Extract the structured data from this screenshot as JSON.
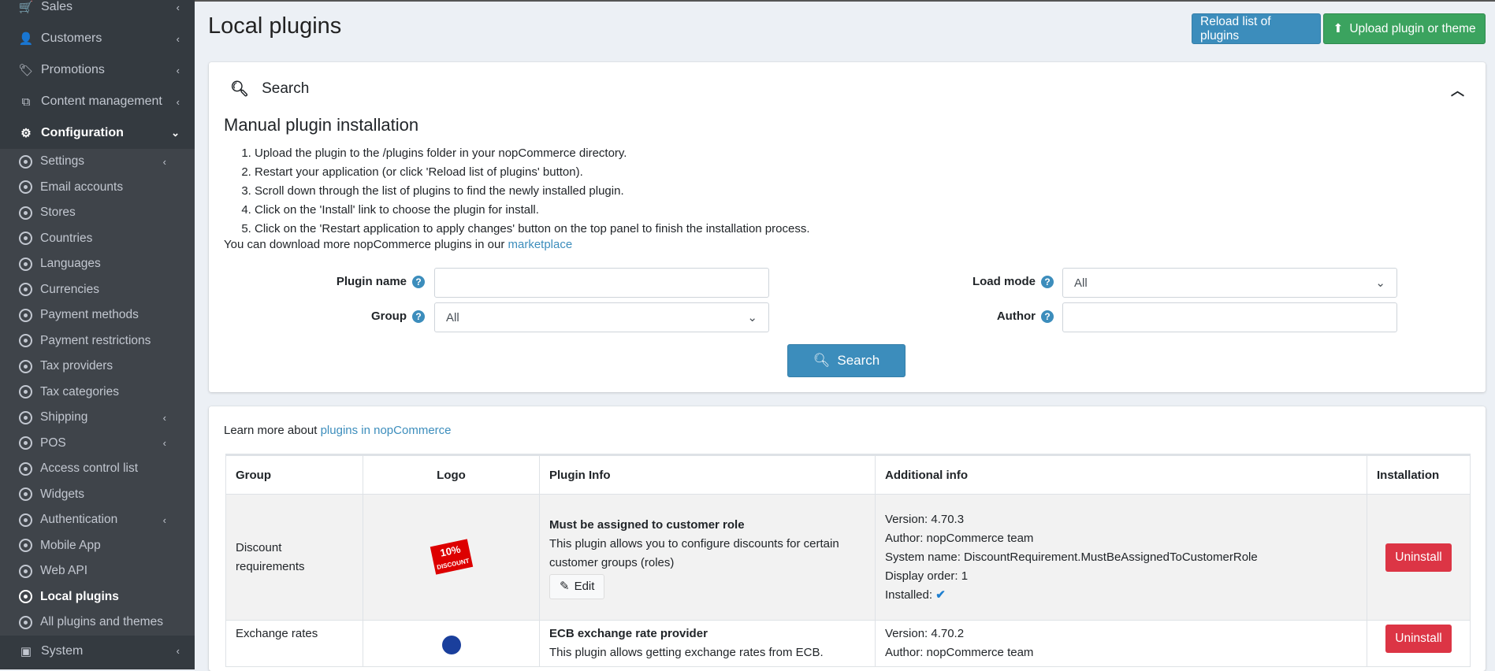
{
  "sidebar": {
    "top_items": [
      {
        "label": "Sales",
        "icon": "cart-icon"
      },
      {
        "label": "Customers",
        "icon": "user-icon"
      },
      {
        "label": "Promotions",
        "icon": "tags-icon"
      },
      {
        "label": "Content management",
        "icon": "cubes-icon"
      },
      {
        "label": "Configuration",
        "icon": "gears-icon"
      }
    ],
    "sub_items": [
      "Settings",
      "Email accounts",
      "Stores",
      "Countries",
      "Languages",
      "Currencies",
      "Payment methods",
      "Payment restrictions",
      "Tax providers",
      "Tax categories",
      "Shipping",
      "POS",
      "Access control list",
      "Widgets",
      "Authentication",
      "Mobile App",
      "Web API",
      "Local plugins",
      "All plugins and themes"
    ],
    "bottom_item": "System"
  },
  "header": {
    "title": "Local plugins",
    "reload_label": "Reload list of plugins",
    "upload_label": "Upload plugin or theme"
  },
  "search": {
    "title": "Search",
    "manual_title": "Manual plugin installation",
    "steps": [
      "Upload the plugin to the /plugins folder in your nopCommerce directory.",
      "Restart your application (or click 'Reload list of plugins' button).",
      "Scroll down through the list of plugins to find the newly installed plugin.",
      "Click on the 'Install' link to choose the plugin for install.",
      "Click on the 'Restart application to apply changes' button on the top panel to finish the installation process."
    ],
    "more_text": "You can download more nopCommerce plugins in our ",
    "more_link": "marketplace",
    "plugin_name_label": "Plugin name",
    "plugin_name_value": "",
    "group_label": "Group",
    "group_value": "All",
    "load_mode_label": "Load mode",
    "load_mode_value": "All",
    "author_label": "Author",
    "author_value": "",
    "search_button": "Search"
  },
  "list": {
    "learn_text": "Learn more about ",
    "learn_link": "plugins in nopCommerce",
    "columns": [
      "Group",
      "Logo",
      "Plugin Info",
      "Additional info",
      "Installation"
    ],
    "rows": [
      {
        "group": "Discount requirements",
        "logo_text": "10% DISCOUNT",
        "name": "Must be assigned to customer role",
        "description": "This plugin allows you to configure discounts for certain customer groups (roles)",
        "edit": "Edit",
        "version": "Version: 4.70.3",
        "author": "Author: nopCommerce team",
        "system_name": "System name: DiscountRequirement.MustBeAssignedToCustomerRole",
        "display_order": "Display order: 1",
        "installed": "Installed:",
        "action": "Uninstall"
      },
      {
        "group": "Exchange rates",
        "name": "ECB exchange rate provider",
        "description": "This plugin allows getting exchange rates from ECB.",
        "version": "Version: 4.70.2",
        "author": "Author: nopCommerce team",
        "action": "Uninstall"
      }
    ]
  }
}
